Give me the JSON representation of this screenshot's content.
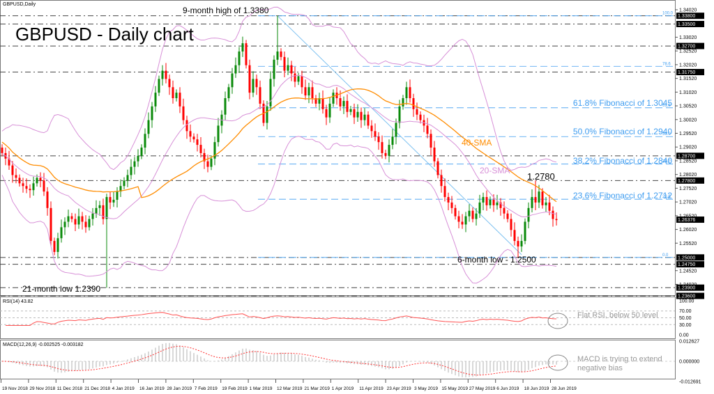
{
  "symbol_label": "GBPUSD,Daily",
  "title": "GBPUSD - Daily chart",
  "annotations": {
    "high": "9-month high of 1.3380",
    "low21": "21-month low 1.2390",
    "low6": "6-month low - 1.2500",
    "level": "1.2780",
    "sma40": "40-SMA",
    "sma20": "20-SMA",
    "rsi_note": "Flat RSI, below 50 level",
    "macd_note_1": "MACD is trying to extend",
    "macd_note_2": "negative bias"
  },
  "fibonacci": [
    {
      "label": "61.8% Fibonacci of 1.3045",
      "ratio": "61.8",
      "price": 1.3045,
      "show_text": true
    },
    {
      "label": "50.0% Fibonacci of 1.2940",
      "ratio": "50.0",
      "price": 1.294,
      "show_text": true
    },
    {
      "label": "38.2% Fibonacci of 1.2840",
      "ratio": "38.2",
      "price": 1.284,
      "show_text": true
    },
    {
      "label": "23.6% Fibonacci of 1.2712",
      "ratio": "23.6",
      "price": 1.2712,
      "show_text": true
    },
    {
      "label": "",
      "ratio": "100.0",
      "price": 1.338,
      "show_text": false
    },
    {
      "label": "",
      "ratio": "78.6",
      "price": 1.3196,
      "show_text": false
    },
    {
      "label": "",
      "ratio": "0.0",
      "price": 1.25,
      "show_text": false
    }
  ],
  "rsi_panel": {
    "label": "RSI(14) 43.82",
    "ticks": [
      "100.00",
      "70.00",
      "50.00",
      "30.00",
      "0.00"
    ]
  },
  "macd_panel": {
    "label": "MACD(12,26,9) -0.002525 -0.003182",
    "ticks": [
      "0.012627",
      "0.000000",
      "-0.012691"
    ]
  },
  "colors": {
    "bull": "#0a8a0a",
    "bear": "#ff0000",
    "sma40": "#ff8c00",
    "bollinger": "#d78fd7",
    "fib": "#3d9cf0",
    "trend": "#7cc0f0",
    "rsi": "#ff5050",
    "macd_signal": "#ff3030",
    "macd_hist": "#b0b0b0"
  },
  "chart_data": {
    "type": "candlestick",
    "title": "GBPUSD - Daily chart",
    "xlabel": "",
    "ylabel": "",
    "ylim": [
      1.236,
      1.3402
    ],
    "x_tick_labels": [
      "19 Nov 2018",
      "29 Nov 2018",
      "11 Dec 2018",
      "21 Dec 2018",
      "4 Jan 2019",
      "16 Jan 2019",
      "28 Jan 2019",
      "7 Feb 2019",
      "19 Feb 2019",
      "1 Mar 2019",
      "12 Mar 2019",
      "21 Mar 2019",
      "1 Apr 2019",
      "11 Apr 2019",
      "23 Apr 2019",
      "3 May 2019",
      "15 May 2019",
      "27 May 2019",
      "6 Jun 2019",
      "18 Jun 2019",
      "28 Jun 2019"
    ],
    "y_tick_labels": [
      "1.34020",
      "1.33020",
      "1.32520",
      "1.32020",
      "1.31520",
      "1.31020",
      "1.30520",
      "1.30020",
      "1.29520",
      "1.29020",
      "1.28520",
      "1.28020",
      "1.27520",
      "1.27020",
      "1.26520",
      "1.26020",
      "1.25520",
      "1.24520",
      "1.24020"
    ],
    "horizontal_levels": [
      {
        "price": 1.338,
        "label": "1.33800"
      },
      {
        "price": 1.335,
        "label": "1.33500"
      },
      {
        "price": 1.327,
        "label": "1.32700"
      },
      {
        "price": 1.3175,
        "label": "1.31750"
      },
      {
        "price": 1.287,
        "label": "1.28700"
      },
      {
        "price": 1.278,
        "label": "1.27800"
      },
      {
        "price": 1.25,
        "label": "1.25000"
      },
      {
        "price": 1.2475,
        "label": "1.24750"
      },
      {
        "price": 1.239,
        "label": "1.23900"
      },
      {
        "price": 1.236,
        "label": "1.23600"
      }
    ],
    "current_price": {
      "price": 1.26376,
      "label": "1.26376"
    },
    "trendline": [
      {
        "index": 79,
        "price": 1.338
      },
      {
        "index": 149,
        "price": 1.251
      }
    ],
    "first_open": 1.29,
    "closes": [
      1.288,
      1.286,
      1.2835,
      1.28,
      1.279,
      1.277,
      1.276,
      1.275,
      1.2745,
      1.277,
      1.279,
      1.278,
      1.274,
      1.268,
      1.256,
      1.252,
      1.257,
      1.261,
      1.263,
      1.265,
      1.264,
      1.262,
      1.265,
      1.263,
      1.261,
      1.264,
      1.266,
      1.268,
      1.269,
      1.264,
      1.272,
      1.27,
      1.271,
      1.274,
      1.276,
      1.278,
      1.28,
      1.283,
      1.285,
      1.287,
      1.29,
      1.295,
      1.3,
      1.305,
      1.31,
      1.315,
      1.318,
      1.315,
      1.312,
      1.308,
      1.31,
      1.305,
      1.3,
      1.296,
      1.294,
      1.293,
      1.291,
      1.288,
      1.285,
      1.283,
      1.286,
      1.292,
      1.298,
      1.302,
      1.308,
      1.312,
      1.317,
      1.32,
      1.325,
      1.328,
      1.32,
      1.31,
      1.315,
      1.312,
      1.306,
      1.299,
      1.305,
      1.315,
      1.322,
      1.325,
      1.323,
      1.318,
      1.32,
      1.317,
      1.314,
      1.316,
      1.312,
      1.309,
      1.312,
      1.308,
      1.306,
      1.308,
      1.304,
      1.301,
      1.306,
      1.31,
      1.308,
      1.305,
      1.307,
      1.303,
      1.304,
      1.301,
      1.303,
      1.3,
      1.302,
      1.298,
      1.296,
      1.294,
      1.292,
      1.288,
      1.287,
      1.291,
      1.294,
      1.299,
      1.305,
      1.308,
      1.312,
      1.308,
      1.304,
      1.302,
      1.3,
      1.298,
      1.295,
      1.29,
      1.285,
      1.28,
      1.276,
      1.272,
      1.27,
      1.268,
      1.265,
      1.263,
      1.262,
      1.265,
      1.267,
      1.264,
      1.266,
      1.27,
      1.272,
      1.269,
      1.271,
      1.269,
      1.27,
      1.268,
      1.266,
      1.264,
      1.26,
      1.256,
      1.254,
      1.256,
      1.263,
      1.268,
      1.272,
      1.27,
      1.274,
      1.269,
      1.27,
      1.267,
      1.264,
      1.2636
    ],
    "extremes": [
      {
        "index": 30,
        "low": 1.239
      },
      {
        "index": 79,
        "high": 1.338
      },
      {
        "index": 148,
        "low": 1.25
      },
      {
        "index": 153,
        "high": 1.278
      }
    ],
    "indicators": [
      "SMA 40",
      "Bollinger Bands (20, 2)",
      "RSI (14)",
      "MACD (12,26,9)"
    ]
  }
}
